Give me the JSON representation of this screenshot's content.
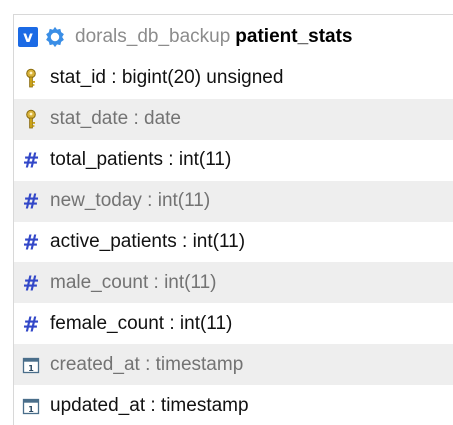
{
  "toggle_label": "v",
  "database": "dorals_db_backup",
  "table": "patient_stats",
  "columns": [
    {
      "label": "stat_id : bigint(20) unsigned",
      "icon": "key-icon"
    },
    {
      "label": "stat_date : date",
      "icon": "key-icon"
    },
    {
      "label": "total_patients : int(11)",
      "icon": "hash-icon"
    },
    {
      "label": "new_today : int(11)",
      "icon": "hash-icon"
    },
    {
      "label": "active_patients : int(11)",
      "icon": "hash-icon"
    },
    {
      "label": "male_count : int(11)",
      "icon": "hash-icon"
    },
    {
      "label": "female_count : int(11)",
      "icon": "hash-icon"
    },
    {
      "label": "created_at : timestamp",
      "icon": "timestamp-icon"
    },
    {
      "label": "updated_at : timestamp",
      "icon": "timestamp-icon"
    }
  ],
  "colors": {
    "toggle_blue": "#1b6ae5",
    "gear_blue": "#3a8ee6",
    "hash_blue": "#3247c8",
    "key_gold": "#c9a21a",
    "row_alt": "#eeeeee"
  }
}
